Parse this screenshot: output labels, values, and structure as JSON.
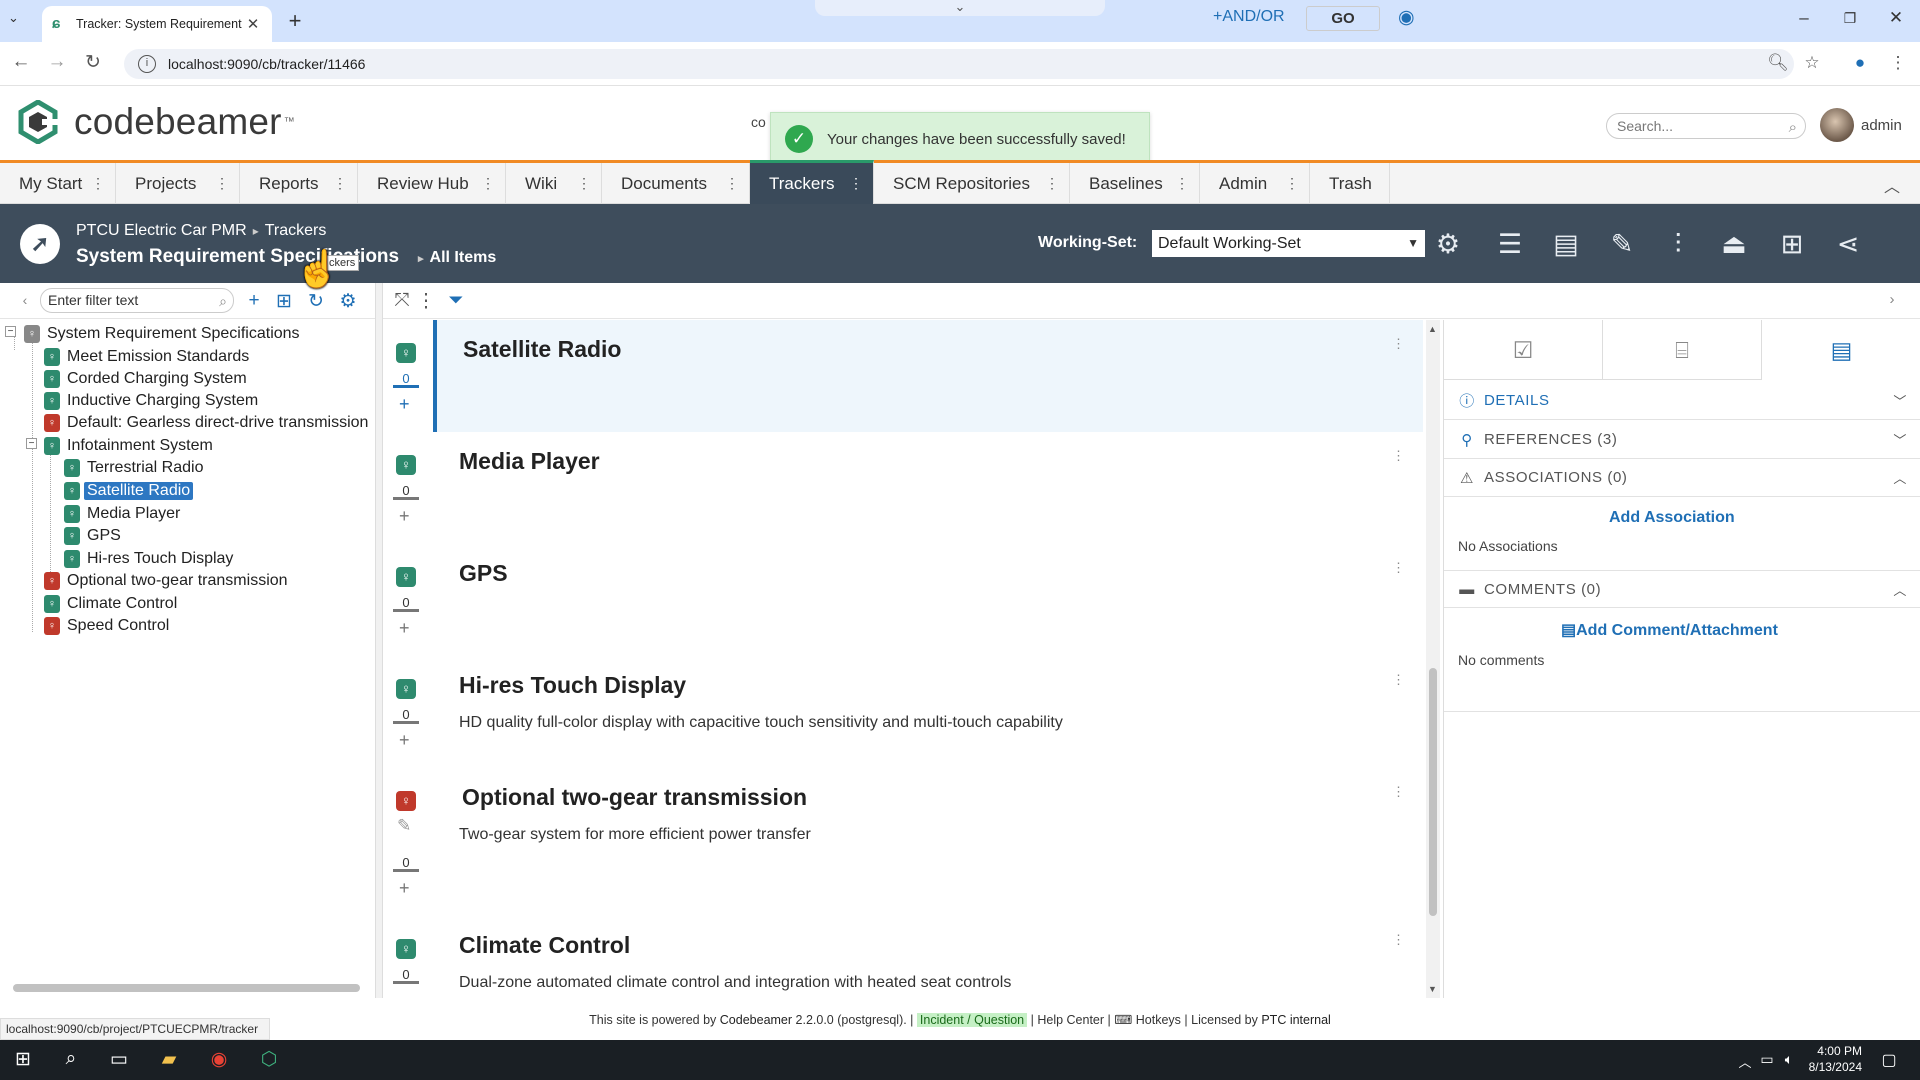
{
  "browser": {
    "tab_title": "Tracker: System Requirement Sp",
    "url": "localhost:9090/cb/tracker/11466"
  },
  "app": {
    "logo_text": "codebeamer",
    "logo_tm": "™",
    "search_placeholder": "Search...",
    "username": "admin",
    "partial_text": "co"
  },
  "toast": {
    "message": "Your changes have been successfully saved!"
  },
  "nav": {
    "tabs": [
      {
        "label": "My Start"
      },
      {
        "label": "Projects"
      },
      {
        "label": "Reports"
      },
      {
        "label": "Review Hub"
      },
      {
        "label": "Wiki"
      },
      {
        "label": "Documents"
      },
      {
        "label": "Trackers"
      },
      {
        "label": "SCM Repositories"
      },
      {
        "label": "Baselines"
      },
      {
        "label": "Admin"
      },
      {
        "label": "Trash"
      }
    ],
    "active": "Trackers"
  },
  "tracker_header": {
    "project": "PTCU Electric Car PMR",
    "section": "Trackers",
    "title": "System Requirement Specifications",
    "view": "All Items",
    "working_set_label": "Working-Set:",
    "working_set_value": "Default Working-Set",
    "tooltip_fragment": "ckers"
  },
  "tree": {
    "filter_placeholder": "Enter filter text",
    "root": "System Requirement Specifications",
    "nodes": [
      {
        "label": "Meet Emission Standards",
        "color": "g"
      },
      {
        "label": "Corded Charging System",
        "color": "g"
      },
      {
        "label": "Inductive Charging System",
        "color": "g"
      },
      {
        "label": "Default: Gearless direct-drive transmission",
        "color": "r"
      },
      {
        "label": "Infotainment System",
        "color": "g"
      },
      {
        "label": "Terrestrial Radio",
        "color": "g"
      },
      {
        "label": "Satellite Radio",
        "color": "g"
      },
      {
        "label": "Media Player",
        "color": "g"
      },
      {
        "label": "GPS",
        "color": "g"
      },
      {
        "label": "Hi-res Touch Display",
        "color": "g"
      },
      {
        "label": "Optional two-gear transmission",
        "color": "r"
      },
      {
        "label": "Climate Control",
        "color": "g"
      },
      {
        "label": "Speed Control",
        "color": "r"
      }
    ]
  },
  "filterbar": {
    "andor": "AND/OR",
    "go": "GO"
  },
  "items": [
    {
      "title": "Satellite Radio",
      "desc": "",
      "count": "0"
    },
    {
      "title": "Media Player",
      "desc": "",
      "count": "0"
    },
    {
      "title": "GPS",
      "desc": "",
      "count": "0"
    },
    {
      "title": "Hi-res Touch Display",
      "desc": "HD quality full-color display with capacitive touch sensitivity and multi-touch capability",
      "count": "0"
    },
    {
      "title": "Optional two-gear transmission",
      "desc": "Two-gear system for more efficient power transfer",
      "count": "0"
    },
    {
      "title": "Climate Control",
      "desc": "Dual-zone automated climate control and integration with heated seat controls",
      "count": "0"
    }
  ],
  "rightpanel": {
    "details": "DETAILS",
    "references": "REFERENCES (3)",
    "associations": "ASSOCIATIONS (0)",
    "add_association": "Add Association",
    "no_associations": "No Associations",
    "comments": "COMMENTS (0)",
    "add_comment": "Add Comment/Attachment",
    "no_comments": "No comments"
  },
  "footer": {
    "status_url": "localhost:9090/cb/project/PTCUECPMR/tracker",
    "powered": "This site is powered by",
    "product": "Codebeamer",
    "version": "2.2.0.0 (postgresql).",
    "incident": "Incident / Question",
    "help": "Help Center",
    "hotkeys": "Hotkeys",
    "licensed": "Licensed by",
    "licensee": "PTC internal"
  },
  "taskbar": {
    "time": "4:00 PM",
    "date": "8/13/2024"
  },
  "colors": {
    "accent": "#1f6fb5",
    "header_dark": "#3e4d5c",
    "green_req": "#2e8a6e",
    "red_req": "#c0392b",
    "nav_orange": "#f08a24"
  }
}
